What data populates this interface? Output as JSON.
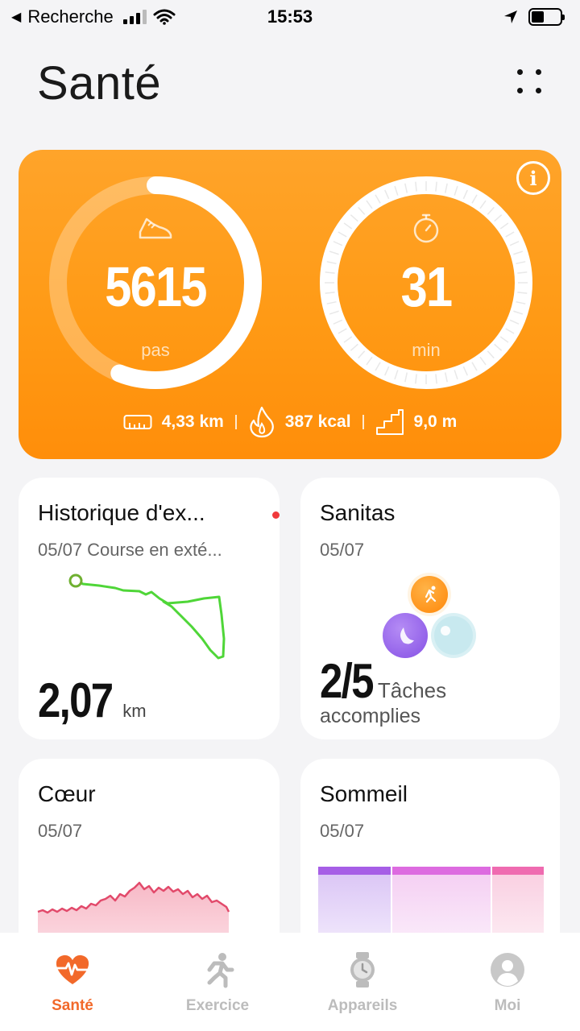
{
  "status_bar": {
    "back_label": "Recherche",
    "time": "15:53"
  },
  "header": {
    "title": "Santé"
  },
  "activity": {
    "steps_value": "5615",
    "steps_unit": "pas",
    "steps_progress": 0.56,
    "time_value": "31",
    "time_unit": "min",
    "time_progress": 1.0,
    "distance": "4,33 km",
    "calories": "387 kcal",
    "elevation": "9,0 m",
    "accent": "#ff9a15"
  },
  "cards": {
    "history": {
      "title": "Historique d'ex...",
      "subtitle": "05/07 Course en exté...",
      "value": "2,07",
      "unit": "km"
    },
    "sanitas": {
      "title": "Sanitas",
      "subtitle": "05/07",
      "value": "2/5",
      "unit": "Tâches",
      "line2": "accomplies"
    },
    "heart": {
      "title": "Cœur",
      "subtitle": "05/07"
    },
    "sleep": {
      "title": "Sommeil",
      "subtitle": "05/07"
    }
  },
  "nav": {
    "items": [
      {
        "label": "Santé",
        "icon": "heart-pulse-icon",
        "active": true
      },
      {
        "label": "Exercice",
        "icon": "runner-icon",
        "active": false
      },
      {
        "label": "Appareils",
        "icon": "watch-icon",
        "active": false
      },
      {
        "label": "Moi",
        "icon": "profile-icon",
        "active": false
      }
    ],
    "active_color": "#f2692a",
    "inactive_color": "#bcbcbc"
  }
}
